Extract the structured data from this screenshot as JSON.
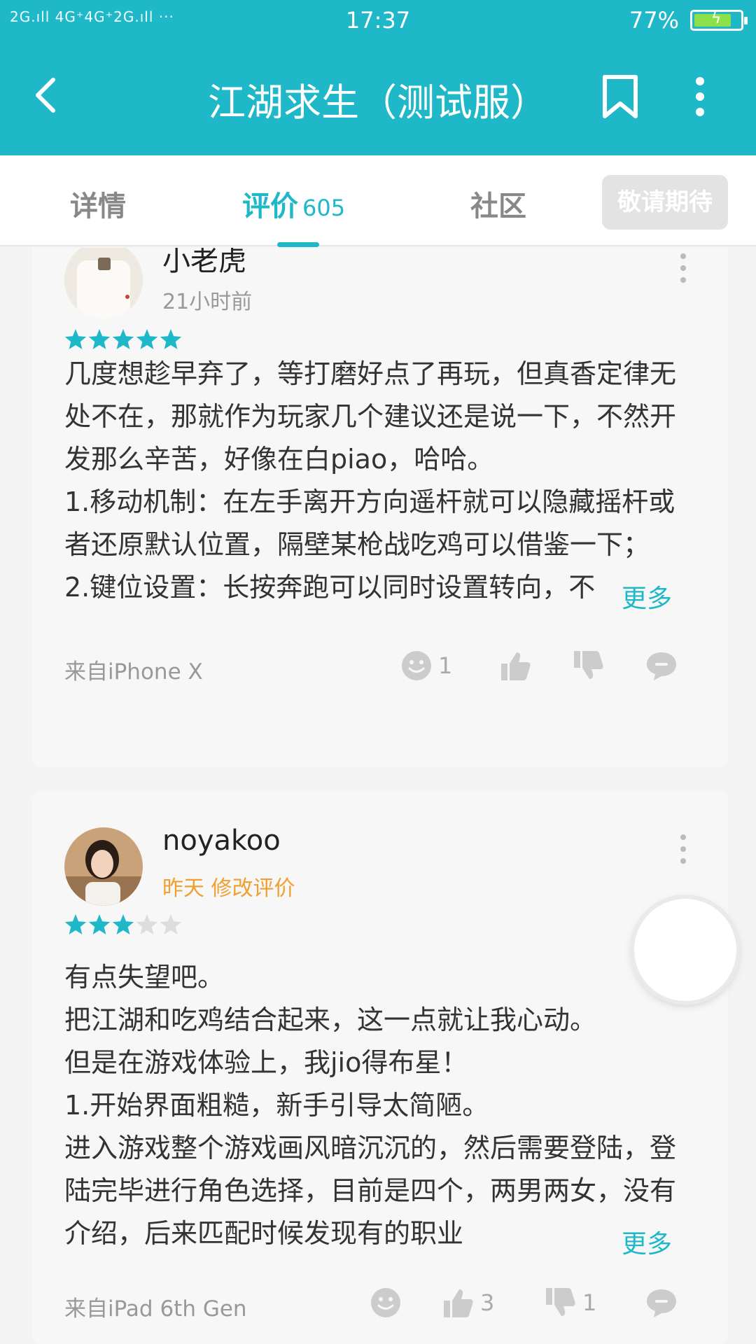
{
  "status_bar": {
    "signal_text": "2G.ıll 4G⁺4G⁺2G.ıll ···",
    "time": "17:37",
    "battery_percent": "77%"
  },
  "header": {
    "title": "江湖求生（测试服）",
    "back_icon": "back-arrow-icon",
    "bookmark_icon": "bookmark-icon",
    "more_icon": "more-vertical-icon"
  },
  "tabs": {
    "items": [
      {
        "label": "详情"
      },
      {
        "label": "评价",
        "count": "605"
      },
      {
        "label": "社区"
      }
    ],
    "expect_button": "敬请期待"
  },
  "reviews": [
    {
      "username": "小老虎",
      "time": "21小时前",
      "rating": 5,
      "body": "几度想趁早弃了，等打磨好点了再玩，但真香定律无处不在，那就作为玩家几个建议还是说一下，不然开发那么辛苦，好像在白piao，哈哈。\n1.移动机制：在左手离开方向遥杆就可以隐藏摇杆或者还原默认位置，隔壁某枪战吃鸡可以借鉴一下；\n2.键位设置：长按奔跑可以同时设置转向，不",
      "more": "更多",
      "device": "来自iPhone X",
      "fun_count": "1",
      "like_count": "",
      "dislike_count": ""
    },
    {
      "username": "noyakoo",
      "time": "昨天 修改评价",
      "rating": 3,
      "body": "有点失望吧。\n把江湖和吃鸡结合起来，这一点就让我心动。\n但是在游戏体验上，我jio得布星！\n1.开始界面粗糙，新手引导太简陋。\n进入游戏整个游戏画风暗沉沉的，然后需要登陆，登陆完毕进行角色选择，目前是四个，两男两女，没有介绍，后来匹配时候发现有的职业",
      "more": "更多",
      "device": "来自iPad 6th Gen",
      "fun_count": "",
      "like_count": "3",
      "dislike_count": "1"
    }
  ],
  "colors": {
    "accent": "#1eb8c8",
    "star_on": "#1eb8c8",
    "star_off": "#dddddd",
    "edited_time": "#f0a030"
  }
}
